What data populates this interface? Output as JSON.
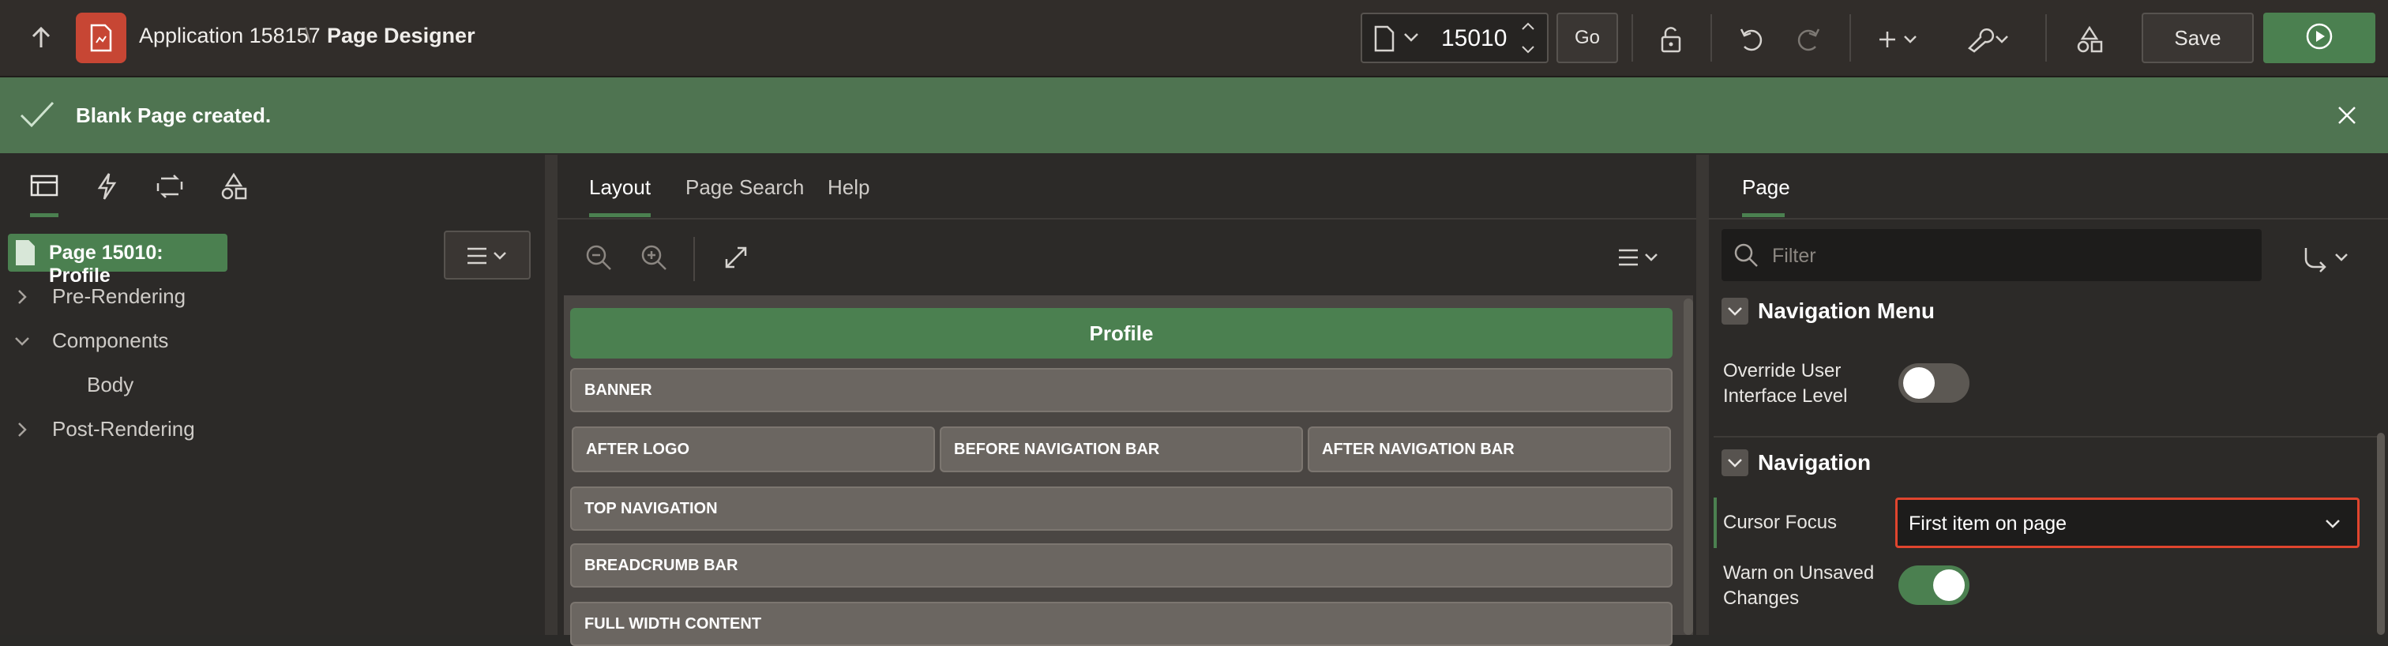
{
  "header": {
    "app_name": "Application 158157",
    "separator": "\\",
    "page_title": "Page Designer",
    "page_number": "15010",
    "go_label": "Go",
    "save_label": "Save"
  },
  "banner": {
    "message": "Blank Page created."
  },
  "left_panel": {
    "selected_page": "Page 15010: Profile",
    "tree": [
      {
        "label": "Pre-Rendering"
      },
      {
        "label": "Components"
      },
      {
        "label": "Body"
      },
      {
        "label": "Post-Rendering"
      }
    ]
  },
  "center_panel": {
    "tabs": [
      "Layout",
      "Page Search",
      "Help"
    ],
    "page_name": "Profile",
    "regions": {
      "banner": "BANNER",
      "after_logo": "AFTER LOGO",
      "before_nav": "BEFORE NAVIGATION BAR",
      "after_nav": "AFTER NAVIGATION BAR",
      "top_nav": "TOP NAVIGATION",
      "breadcrumb": "BREADCRUMB BAR",
      "full_width": "FULL WIDTH CONTENT"
    }
  },
  "right_panel": {
    "tab": "Page",
    "filter_placeholder": "Filter",
    "nav_menu_section": "Navigation Menu",
    "override_label_1": "Override User",
    "override_label_2": "Interface Level",
    "override_value": false,
    "nav_section": "Navigation",
    "cursor_focus_label": "Cursor Focus",
    "cursor_focus_value": "First item on page",
    "warn_label_1": "Warn on Unsaved",
    "warn_label_2": "Changes",
    "warn_value": true
  },
  "colors": {
    "accent_green": "#4b8050",
    "app_icon_red": "#c74634",
    "highlight_border": "#e0452e"
  }
}
